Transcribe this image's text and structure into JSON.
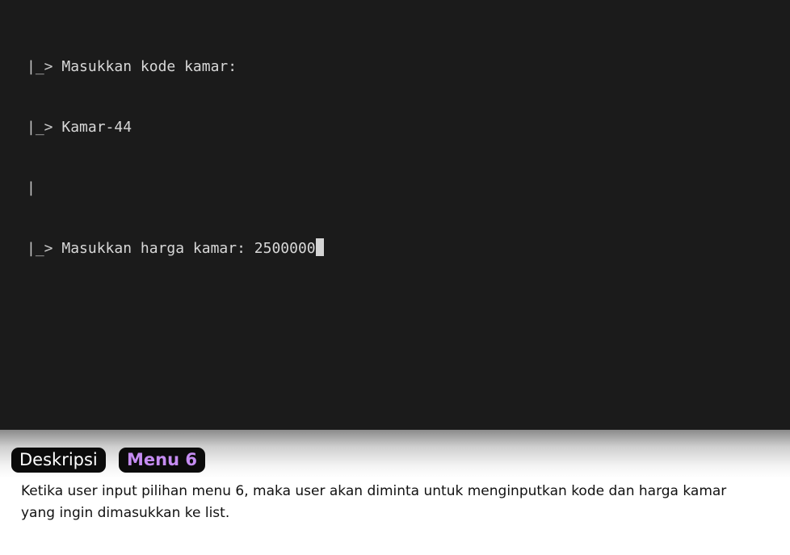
{
  "terminal": {
    "lines": [
      {
        "prefix": "|_> ",
        "text": "Masukkan kode kamar:"
      },
      {
        "prefix": "|_> ",
        "text": "Kamar-44"
      },
      {
        "prefix": "|",
        "text": ""
      },
      {
        "prefix": "|_> ",
        "text": "Masukkan harga kamar: 2500000"
      }
    ],
    "colors": {
      "background": "#1b1b1b",
      "text": "#d8d8d8"
    }
  },
  "footer": {
    "badge_label": "Deskripsi",
    "menu_badge_label": "Menu 6",
    "description": "Ketika user input pilihan menu 6, maka user akan diminta untuk menginputkan kode dan harga kamar yang ingin dimasukkan ke list.",
    "colors": {
      "badge_bg": "#0b0b0b",
      "menu_badge_text": "#c58cf2"
    }
  }
}
